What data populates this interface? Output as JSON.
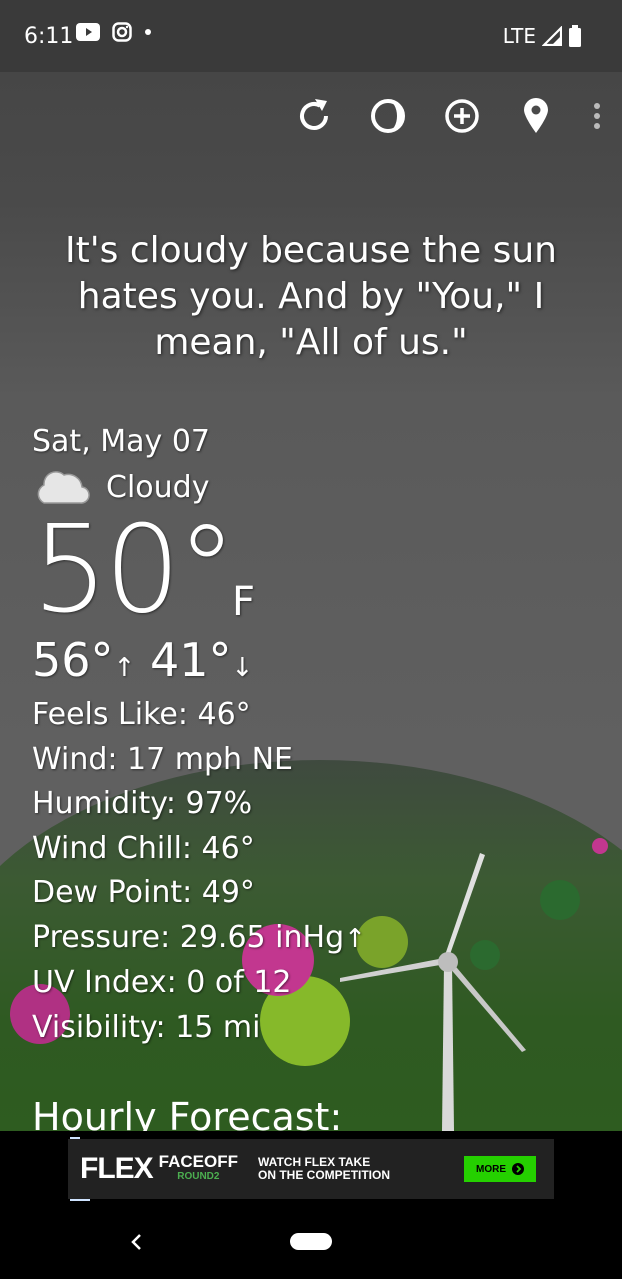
{
  "status_bar": {
    "time": "6:11",
    "network": "LTE",
    "icons": [
      "youtube-icon",
      "instagram-icon",
      "notification-dot-icon",
      "signal-icon",
      "battery-icon"
    ]
  },
  "toolbar": {
    "icons": [
      "refresh-icon",
      "theme-icon",
      "add-location-icon",
      "location-pin-icon",
      "more-vert-icon"
    ]
  },
  "quote": "It's cloudy because the sun hates you. And by \"You,\" I mean, \"All of us.\"",
  "weather": {
    "date": "Sat, May 07",
    "condition": "Cloudy",
    "condition_icon": "cloud-icon",
    "temperature": "50°",
    "unit": "F",
    "high": "56°",
    "low": "41°",
    "high_arrow": "↑",
    "low_arrow": "↓"
  },
  "details": {
    "feels_like": "Feels Like:  46°",
    "wind": "Wind:  17 mph NE",
    "humidity": "Humidity:  97%",
    "wind_chill": "Wind Chill:  46°",
    "dew_point": "Dew Point:  49°",
    "pressure": "Pressure:  29.65 inHg",
    "pressure_arrow": "↑",
    "uv_index": "UV Index:  0 of 12",
    "visibility": "Visibility:  15 mi"
  },
  "hourly_title": "Hourly Forecast:",
  "ad": {
    "brand": "FLEX",
    "faceoff": "FACEOFF",
    "round": "ROUND2",
    "line1": "WATCH FLEX TAKE",
    "line2": "ON THE COMPETITION",
    "more": "MORE"
  },
  "colors": {
    "sky": "#4a4a4a",
    "status_bar": "#3a3a3a",
    "ad_button": "#25d000",
    "ground": "#2f5a22"
  }
}
